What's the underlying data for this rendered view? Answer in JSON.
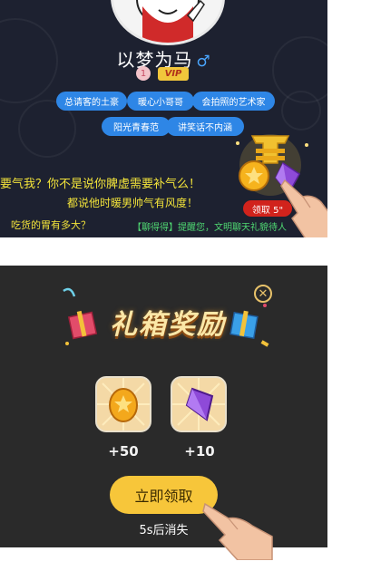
{
  "profile": {
    "name": "以梦为马",
    "gender_symbol": "♂",
    "level": "1",
    "vip_label": "VIP"
  },
  "tags": [
    "总请客的土豪",
    "暖心小哥哥",
    "会拍照的艺术家",
    "阳光青春范",
    "讲笑话不内涵"
  ],
  "chat": {
    "line1": "要气我？你不是说你脾虚需要补气么！",
    "line2": "都说他时暖男帅气有风度！",
    "line3": "吃货的胃有多大？",
    "line4": "【聊得得】提醒您，文明聊天礼貌待人"
  },
  "gift_entry": {
    "claim_label": "领取 5\""
  },
  "reward_popup": {
    "title": "礼箱奖励",
    "close_symbol": "✕",
    "items": [
      {
        "icon": "gold-coin-icon",
        "amount": "+50"
      },
      {
        "icon": "purple-diamond-icon",
        "amount": "+10"
      }
    ],
    "claim_button": "立即领取",
    "countdown": "5s后消失"
  },
  "colors": {
    "top_bg": "#1d2130",
    "popup_bg": "#2a2a2a",
    "tag_blue": "#2e86e6",
    "chat_yellow": "#f2e33a",
    "chat_green": "#4fd872",
    "button_gold": "#f7c63a",
    "claim_red": "#d1231c"
  }
}
